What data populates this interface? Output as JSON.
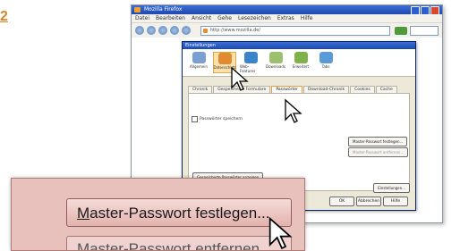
{
  "step_number": "2",
  "browser": {
    "title": "Mozilla Firefox",
    "menu": [
      "Datei",
      "Bearbeiten",
      "Ansicht",
      "Gehe",
      "Lesezeichen",
      "Extras",
      "Hilfe"
    ],
    "url": "http://www.mozilla.de/"
  },
  "dialog": {
    "title": "Einstellungen",
    "categories": [
      {
        "label": "Allgemein",
        "color": "#7a9fd0"
      },
      {
        "label": "Datenschutz",
        "color": "#e08a32"
      },
      {
        "label": "Web-Features",
        "color": "#3c84c9"
      },
      {
        "label": "Downloads",
        "color": "#9dbf70"
      },
      {
        "label": "Erweitert",
        "color": "#7fb24a"
      },
      {
        "label": "Tabs",
        "color": "#5a9ad6"
      }
    ],
    "selected_category": "Datenschutz",
    "tabs": [
      "Chronik",
      "Gespeicherte Formulare",
      "Passwörter",
      "Download-Chronik",
      "Cookies",
      "Cache"
    ],
    "selected_tab": "Passwörter",
    "checkbox_label": "Passwörter speichern",
    "btn_master": "Master-Passwort festlegen...",
    "btn_master_remove": "Master-Passwort entfernen...",
    "btn_saved": "Gespeicherte Passwörter anzeigen",
    "btn_ok": "OK",
    "btn_cancel": "Abbrechen",
    "btn_help": "Hilfe",
    "btn_clear": "Einstellungen..."
  },
  "zoom": {
    "master_button_prefix": "M",
    "master_button_rest": "aster-Passwort festlegen...",
    "next_button": "Master-Passwort entfernen..."
  },
  "colors": {
    "step_color": "#d9862a",
    "zoom_bg": "#e8c1bd"
  }
}
